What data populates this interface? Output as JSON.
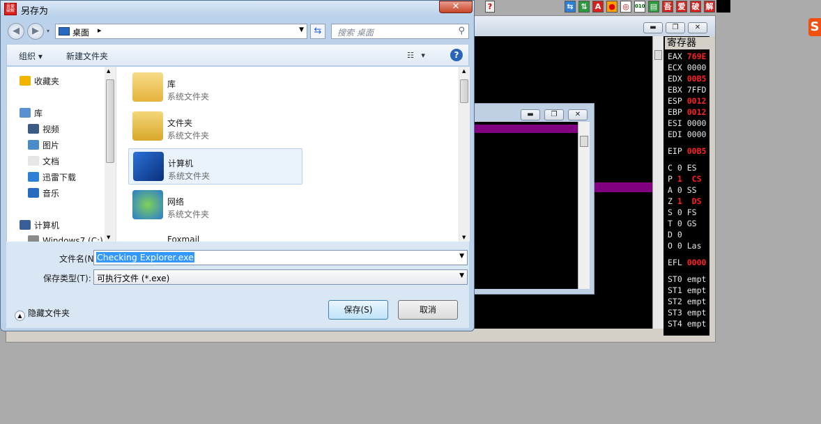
{
  "dialog": {
    "title": "另存为",
    "icon_text": "吾爱破解",
    "close": "✕"
  },
  "nav": {
    "back": "◀",
    "forward": "▶",
    "address": "桌面",
    "address_arrow": "▸",
    "search_placeholder": "搜索 桌面"
  },
  "toolbar": {
    "organize": "组织 ▾",
    "new_folder": "新建文件夹",
    "help": "?"
  },
  "navpane": {
    "items": [
      {
        "label": "收藏夹",
        "icon": "star-icon"
      },
      {
        "label": "库",
        "icon": "library-icon"
      },
      {
        "label": "视频",
        "icon": "video-icon"
      },
      {
        "label": "图片",
        "icon": "picture-icon"
      },
      {
        "label": "文档",
        "icon": "document-icon"
      },
      {
        "label": "迅雷下载",
        "icon": "download-icon"
      },
      {
        "label": "音乐",
        "icon": "music-icon"
      },
      {
        "label": "计算机",
        "icon": "computer-icon"
      },
      {
        "label": "Windows7 (C:)",
        "icon": "drive-icon"
      }
    ]
  },
  "files": [
    {
      "name": "库",
      "type": "系统文件夹",
      "icon": "library-folder-icon"
    },
    {
      "name": "文件夹",
      "type": "系统文件夹",
      "icon": "user-folder-icon"
    },
    {
      "name": "计算机",
      "type": "系统文件夹",
      "icon": "computer-icon"
    },
    {
      "name": "网络",
      "type": "系统文件夹",
      "icon": "network-icon"
    },
    {
      "name": "Foxmail",
      "type": "",
      "icon": "foxmail-icon"
    }
  ],
  "form": {
    "filename_label": "文件名(N):",
    "filename_value": "Checking Explorer.exe",
    "filetype_label": "保存类型(T):",
    "filetype_value": "可执行文件 (*.exe)",
    "save": "保存(S)",
    "cancel": "取消",
    "hide_folders": "隐藏文件夹"
  },
  "topbar": {
    "buttons": [
      "⇆",
      "⇅",
      "A",
      "●",
      "◎",
      "010",
      "▤",
      "吾",
      "爱",
      "破",
      "解"
    ],
    "extra": "?"
  },
  "registers": {
    "header": "寄存器",
    "lines": [
      {
        "name": "EAX",
        "value": "769E",
        "red": true
      },
      {
        "name": "ECX",
        "value": "0000",
        "red": false
      },
      {
        "name": "EDX",
        "value": "00B5",
        "red": true
      },
      {
        "name": "EBX",
        "value": "7FFD",
        "red": false
      },
      {
        "name": "ESP",
        "value": "0012",
        "red": true
      },
      {
        "name": "EBP",
        "value": "0012",
        "red": true
      },
      {
        "name": "ESI",
        "value": "0000",
        "red": false
      },
      {
        "name": "EDI",
        "value": "0000",
        "red": false
      },
      {
        "name": "EIP",
        "value": "00B5",
        "red": true
      },
      {
        "name": "C 0",
        "value": "ES",
        "red": false
      },
      {
        "name": "P",
        "value": "1  CS",
        "red": true
      },
      {
        "name": "A 0",
        "value": "SS",
        "red": false
      },
      {
        "name": "Z",
        "value": "1  DS",
        "red": true
      },
      {
        "name": "S 0",
        "value": "FS",
        "red": false
      },
      {
        "name": "T 0",
        "value": "GS",
        "red": false
      },
      {
        "name": "D 0",
        "value": "",
        "red": false
      },
      {
        "name": "O 0",
        "value": "Las",
        "red": false
      },
      {
        "name": "EFL",
        "value": "0000",
        "red": true
      },
      {
        "name": "ST0",
        "value": "empt",
        "red": false
      },
      {
        "name": "ST1",
        "value": "empt",
        "red": false
      },
      {
        "name": "ST2",
        "value": "empt",
        "red": false
      },
      {
        "name": "ST3",
        "value": "empt",
        "red": false
      },
      {
        "name": "ST4",
        "value": "empt",
        "red": false
      }
    ]
  },
  "colors": {
    "purple": "#800080",
    "register_red": "#ff2020"
  }
}
